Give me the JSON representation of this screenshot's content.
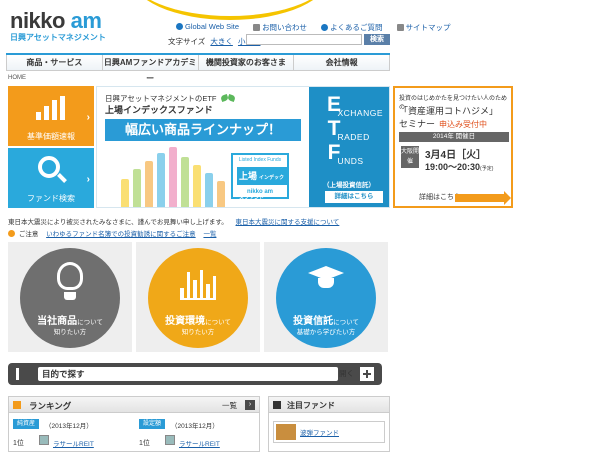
{
  "header": {
    "logo_main": "nikko",
    "logo_accent": "am",
    "logo_sub": "日興アセットマネジメント",
    "util_links": [
      "Global Web Site",
      "お問い合わせ",
      "よくあるご質問",
      "サイトマップ"
    ],
    "font_size_label": "文字サイズ",
    "font_size_large": "大きく",
    "font_size_small": "小さく",
    "search_value": "",
    "search_button": "検索"
  },
  "nav": [
    "商品・サービス",
    "日興AMファンドアカデミー",
    "機関投資家のお客さま",
    "会社情報"
  ],
  "breadcrumb": "HOME",
  "quick": {
    "price_label": "基準価額速報",
    "fund_search_label": "ファンド検索"
  },
  "banner": {
    "line1": "日興アセットマネジメントのETF",
    "line2": "上場インデックスファンド",
    "headline": "幅広い商品ラインナップ！",
    "badge_top": "Listed Index Funds",
    "badge_main": "上場",
    "badge_small": "インデックスファンド",
    "badge_brand": "nikko am",
    "etf_letters": [
      "E",
      "T",
      "F"
    ],
    "etf_words": [
      "XCHANGE",
      "RADED",
      "UNDS"
    ],
    "etf_sub": "（上場投資信託）",
    "etf_detail": "詳細はこちら"
  },
  "seminar": {
    "intro": "投資のはじめかたを見つけたい人のための",
    "title": "「資産運用コトハジメ」",
    "title2": "セミナー",
    "status": "申込み受付中",
    "year": "2014年 開催日",
    "venue": "大阪開催",
    "date": "3月4日［火］",
    "time": "19:00～20:30",
    "time_note": "(予定)",
    "detail": "詳細はこちら"
  },
  "notices": {
    "quake": "東日本大震災により被災されたみなさまに、謹んでお見舞い申し上げます。",
    "quake_link": "東日本大震災に関する支援について",
    "warning_label": "ご注意",
    "warning_link": "いわゆるファンド名簿での投資勧誘に関するご注意",
    "list_link": "一覧"
  },
  "circles": [
    {
      "title": "当社商品",
      "suffix": "について",
      "sub": "知りたい方"
    },
    {
      "title": "投資環境",
      "suffix": "について",
      "sub": "知りたい方"
    },
    {
      "title": "投資信託",
      "suffix": "について",
      "sub": "基礎から学びたい方"
    }
  ],
  "purpose_bar": {
    "label": "目的で探す",
    "open": "開く"
  },
  "ranking": {
    "title": "ランキング",
    "all": "一覧",
    "tag1": "純資産",
    "tag2": "設定額",
    "period1": "（2013年12月）",
    "period2": "（2013年12月）",
    "pos1": "1位",
    "pos2": "1位",
    "fund1": "ラサールREIT",
    "fund2": "ラサールREIT"
  },
  "featured": {
    "title": "注目ファンド",
    "fund": "波弾ファンド"
  }
}
